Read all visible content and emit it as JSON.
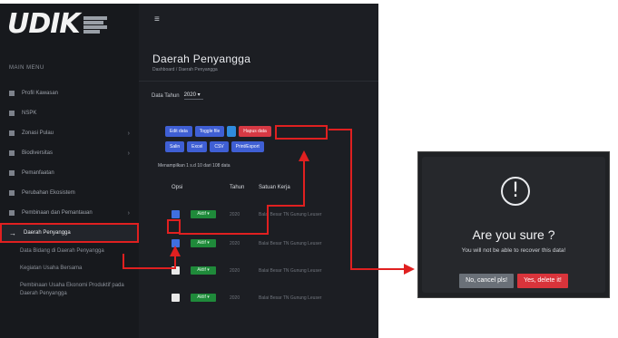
{
  "logo": {
    "text": "UDIK"
  },
  "sidebar": {
    "heading": "MAIN MENU",
    "items": [
      {
        "label": "Profil Kawasan",
        "chevron": ""
      },
      {
        "label": "NSPK",
        "chevron": ""
      },
      {
        "label": "Zonasi Pulau",
        "chevron": "›"
      },
      {
        "label": "Biodiversitas",
        "chevron": "›"
      },
      {
        "label": "Pemanfaatan",
        "chevron": ""
      },
      {
        "label": "Perubahan Ekosistem",
        "chevron": ""
      },
      {
        "label": "Pembinaan dan Pemantauan",
        "chevron": "›"
      },
      {
        "label": "Daerah Penyangga",
        "chevron": ""
      }
    ],
    "subitems": [
      "Data Bidang di Daerah Penyangga",
      "Kegiatan Usaha Bersama",
      "Pembinaan Usaha Ekonomi Produktif pada Daerah Penyangga"
    ]
  },
  "header": {
    "menu_icon": "≡"
  },
  "page": {
    "title": "Daerah Penyangga",
    "breadcrumb": "Dashboard / Daerah Penyangga"
  },
  "filter": {
    "label": "Data Tahun",
    "value": "2020 ▾"
  },
  "buttons": {
    "row1": [
      "Edit data",
      "Toggle file",
      "",
      "Hapus data"
    ],
    "row2": [
      "Salin",
      "Excel",
      "CSV",
      "Print/Export"
    ]
  },
  "table": {
    "info": "Menampilkan 1 s.d 10 dari 108 data",
    "columns": [
      "Opsi",
      "Tahun",
      "Satuan Kerja"
    ],
    "rows": [
      {
        "checked": true,
        "badge": "Aktif ▾",
        "year": "2020",
        "area": "Balai Besar TN Gunung Leuser"
      },
      {
        "checked": true,
        "badge": "Aktif ▾",
        "year": "2020",
        "area": "Balai Besar TN Gunung Leuser"
      },
      {
        "checked": false,
        "badge": "Aktif ▾",
        "year": "2020",
        "area": "Balai Besar TN Gunung Leuser"
      },
      {
        "checked": false,
        "badge": "Aktif ▾",
        "year": "2020",
        "area": "Balai Besar TN Gunung Leuser"
      }
    ]
  },
  "dialog": {
    "icon": "!",
    "title": "Are you sure ?",
    "text": "You will not be able to recover this data!",
    "cancel_label": "No, cancel pls!",
    "confirm_label": "Yes, delete it!"
  },
  "colors": {
    "annotation": "#e02020",
    "danger": "#d63944",
    "primary": "#3f5fd4",
    "success": "#1f8a3a",
    "sidebar_bg": "#17191d",
    "content_bg": "#1c1e23"
  }
}
